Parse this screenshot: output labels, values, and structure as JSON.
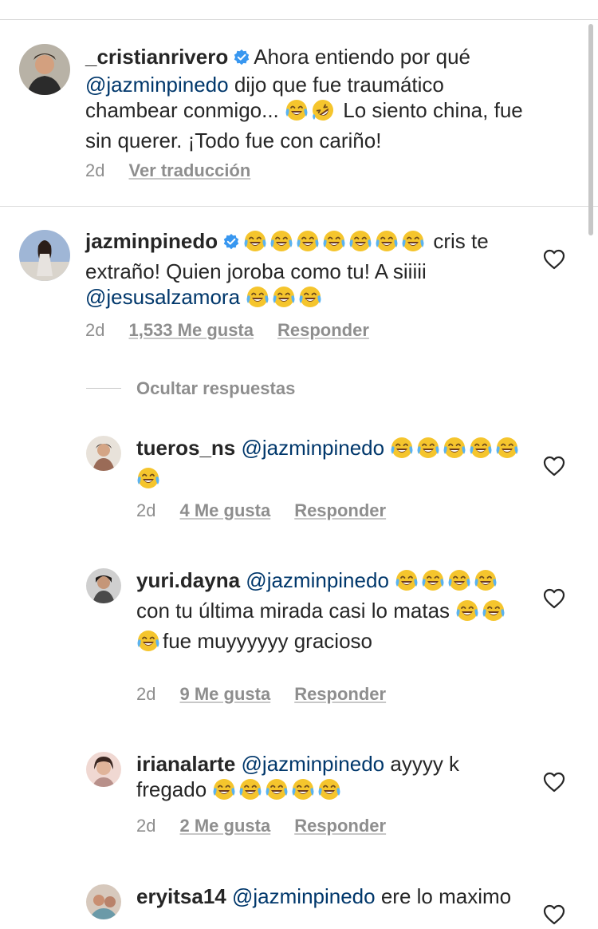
{
  "caption": {
    "username": "_cristianrivero",
    "parts": [
      {
        "t": "text",
        "v": "Ahora entiendo por qué "
      },
      {
        "t": "mention",
        "v": "@jazminpinedo"
      },
      {
        "t": "text",
        "v": " dijo que fue traumático chambear conmigo... "
      },
      {
        "t": "emoji",
        "v": "joy"
      },
      {
        "t": "emoji",
        "v": "rofl"
      },
      {
        "t": "text",
        "v": " Lo siento china, fue sin querer. ¡Todo fue con cariño!"
      }
    ],
    "time": "2d",
    "translate_label": "Ver traducción"
  },
  "comment": {
    "username": "jazminpinedo",
    "parts": [
      {
        "t": "emoji",
        "v": "joy"
      },
      {
        "t": "emoji",
        "v": "joy"
      },
      {
        "t": "emoji",
        "v": "joy"
      },
      {
        "t": "emoji",
        "v": "joy"
      },
      {
        "t": "emoji",
        "v": "joy"
      },
      {
        "t": "emoji",
        "v": "joy"
      },
      {
        "t": "emoji",
        "v": "joy"
      },
      {
        "t": "text",
        "v": " cris te extraño! Quien joroba como tu! A siiiii "
      },
      {
        "t": "mention",
        "v": "@jesusalzamora"
      },
      {
        "t": "text",
        "v": " "
      },
      {
        "t": "emoji",
        "v": "joy"
      },
      {
        "t": "emoji",
        "v": "joy"
      },
      {
        "t": "emoji",
        "v": "joy"
      }
    ],
    "time": "2d",
    "likes": "1,533 Me gusta",
    "reply_label": "Responder"
  },
  "hide_replies_label": "Ocultar respuestas",
  "replies": [
    {
      "username": "tueros_ns",
      "parts": [
        {
          "t": "mention",
          "v": "@jazminpinedo"
        },
        {
          "t": "text",
          "v": " "
        },
        {
          "t": "emoji",
          "v": "joy"
        },
        {
          "t": "emoji",
          "v": "joy"
        },
        {
          "t": "emoji",
          "v": "joy"
        },
        {
          "t": "emoji",
          "v": "joy"
        },
        {
          "t": "emoji",
          "v": "joy"
        },
        {
          "t": "emoji",
          "v": "joy"
        }
      ],
      "time": "2d",
      "likes": "4 Me gusta",
      "reply_label": "Responder"
    },
    {
      "username": "yuri.dayna",
      "parts": [
        {
          "t": "mention",
          "v": "@jazminpinedo"
        },
        {
          "t": "text",
          "v": " "
        },
        {
          "t": "emoji",
          "v": "joy"
        },
        {
          "t": "emoji",
          "v": "joy"
        },
        {
          "t": "emoji",
          "v": "joy"
        },
        {
          "t": "emoji",
          "v": "joy"
        },
        {
          "t": "text",
          "v": "con tu última mirada casi lo matas "
        },
        {
          "t": "emoji",
          "v": "joy"
        },
        {
          "t": "emoji",
          "v": "joy"
        },
        {
          "t": "emoji",
          "v": "joy"
        },
        {
          "t": "text",
          "v": "fue muyyyyyy gracioso"
        }
      ],
      "time": "2d",
      "likes": "9 Me gusta",
      "reply_label": "Responder"
    },
    {
      "username": "irianalarte",
      "parts": [
        {
          "t": "mention",
          "v": "@jazminpinedo"
        },
        {
          "t": "text",
          "v": " ayyyy k fregado "
        },
        {
          "t": "emoji",
          "v": "joy"
        },
        {
          "t": "emoji",
          "v": "joy"
        },
        {
          "t": "emoji",
          "v": "joy"
        },
        {
          "t": "emoji",
          "v": "joy"
        },
        {
          "t": "emoji",
          "v": "joy"
        }
      ],
      "time": "2d",
      "likes": "2 Me gusta",
      "reply_label": "Responder"
    },
    {
      "username": "eryitsa14",
      "parts": [
        {
          "t": "mention",
          "v": "@jazminpinedo"
        },
        {
          "t": "text",
          "v": " ere lo maximo"
        }
      ]
    }
  ],
  "colors": {
    "text": "#262626",
    "mention": "#00376b",
    "secondary": "#8e8e8e",
    "verified": "#3897f0",
    "divider": "#dbdbdb"
  },
  "icons": {
    "verified": "verified-badge-icon",
    "heart": "heart-outline-icon",
    "emoji_joy": "face-with-tears-of-joy",
    "emoji_rofl": "rolling-on-floor-laughing"
  }
}
